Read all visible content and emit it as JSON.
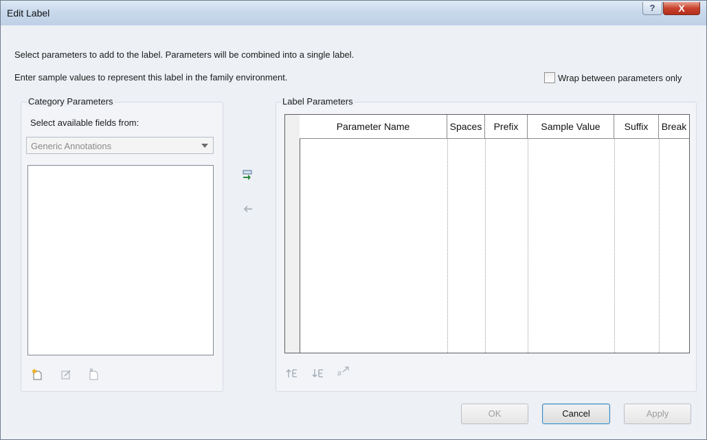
{
  "window": {
    "title": "Edit Label",
    "help_icon": "?",
    "close_icon": "X"
  },
  "instructions": {
    "line1": "Select parameters to add to the label.  Parameters will be combined into a single label.",
    "line2": "Enter sample values to represent this label in the family environment."
  },
  "wrap": {
    "label": "Wrap between parameters only",
    "checked": false
  },
  "category": {
    "title": "Category Parameters",
    "select_label": "Select available fields from:",
    "dropdown_value": "Generic Annotations",
    "icons": [
      "new-parameter-icon",
      "edit-parameter-icon",
      "delete-parameter-icon"
    ]
  },
  "transfer_icons": [
    "add-to-label-icon",
    "remove-from-label-icon"
  ],
  "label_params": {
    "title": "Label Parameters",
    "columns": [
      "Parameter Name",
      "Spaces",
      "Prefix",
      "Sample Value",
      "Suffix",
      "Break"
    ],
    "rows": [],
    "icons": [
      "move-up-icon",
      "move-down-icon",
      "edit-format-icon"
    ]
  },
  "buttons": {
    "ok": "OK",
    "cancel": "Cancel",
    "apply": "Apply"
  },
  "colors": {
    "titlebar": "#c9d9ec",
    "close": "#c8422d",
    "dialog_bg": "#edf0f5"
  }
}
